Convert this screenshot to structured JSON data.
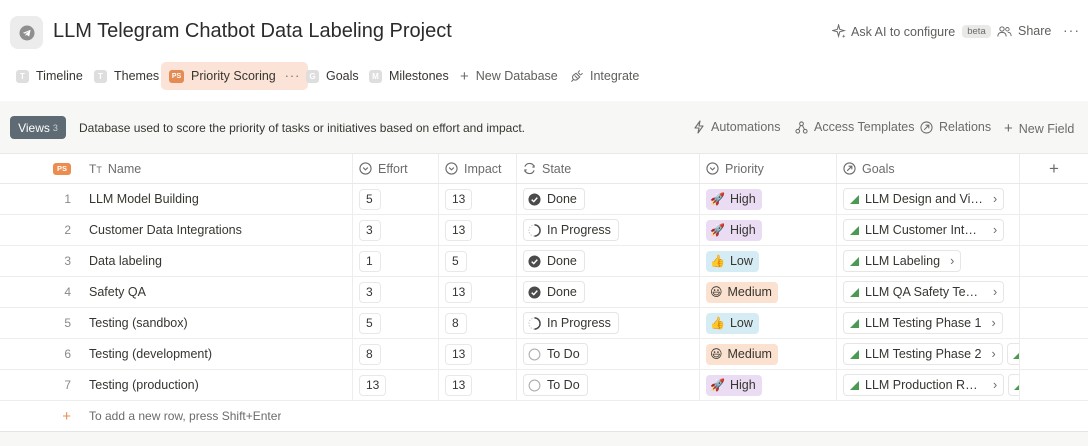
{
  "page": {
    "title": "LLM Telegram Chatbot Data Labeling Project"
  },
  "header": {
    "ask_ai": "Ask AI to configure",
    "beta": "beta",
    "share": "Share"
  },
  "tabs": [
    {
      "letter": "T",
      "label": "Timeline"
    },
    {
      "letter": "T",
      "label": "Themes"
    },
    {
      "letter": "PS",
      "label": "Priority Scoring"
    },
    {
      "letter": "G",
      "label": "Goals"
    },
    {
      "letter": "M",
      "label": "Milestones"
    }
  ],
  "tab_actions": {
    "new_database": "New Database",
    "integrate": "Integrate"
  },
  "toolbar": {
    "views": "Views",
    "views_count": "3",
    "description": "Database used to score the priority of tasks or initiatives based on effort and impact.",
    "automations": "Automations",
    "access_templates": "Access Templates",
    "relations": "Relations",
    "new_field": "New Field"
  },
  "table": {
    "badge": "PS",
    "columns": {
      "name": "Name",
      "effort": "Effort",
      "impact": "Impact",
      "state": "State",
      "priority": "Priority",
      "goals": "Goals"
    },
    "rows": [
      {
        "idx": "1",
        "name": "LLM Model Building",
        "effort": "5",
        "impact": "13",
        "state": "Done",
        "priority": "High",
        "goal": "LLM Design and Visi…"
      },
      {
        "idx": "2",
        "name": "Customer Data Integrations",
        "effort": "3",
        "impact": "13",
        "state": "In Progress",
        "priority": "High",
        "goal": "LLM Customer Integ…"
      },
      {
        "idx": "3",
        "name": "Data labeling",
        "effort": "1",
        "impact": "5",
        "state": "Done",
        "priority": "Low",
        "goal": "LLM Labeling"
      },
      {
        "idx": "4",
        "name": "Safety QA",
        "effort": "3",
        "impact": "13",
        "state": "Done",
        "priority": "Medium",
        "goal": "LLM QA Safety Testing"
      },
      {
        "idx": "5",
        "name": "Testing (sandbox)",
        "effort": "5",
        "impact": "8",
        "state": "In Progress",
        "priority": "Low",
        "goal": "LLM Testing Phase 1"
      },
      {
        "idx": "6",
        "name": "Testing (development)",
        "effort": "8",
        "impact": "13",
        "state": "To Do",
        "priority": "Medium",
        "goal": "LLM Testing Phase 2"
      },
      {
        "idx": "7",
        "name": "Testing (production)",
        "effort": "13",
        "impact": "13",
        "state": "To Do",
        "priority": "High",
        "goal": "LLM Production Rele…"
      }
    ],
    "add_row_hint": "To add a new row, press Shift+Enter"
  },
  "colors": {
    "accent": "#ec8c4e",
    "views_button": "#5f6b74",
    "active_tab": "#fbe4d7",
    "goal_icon": "#4a9a52"
  }
}
